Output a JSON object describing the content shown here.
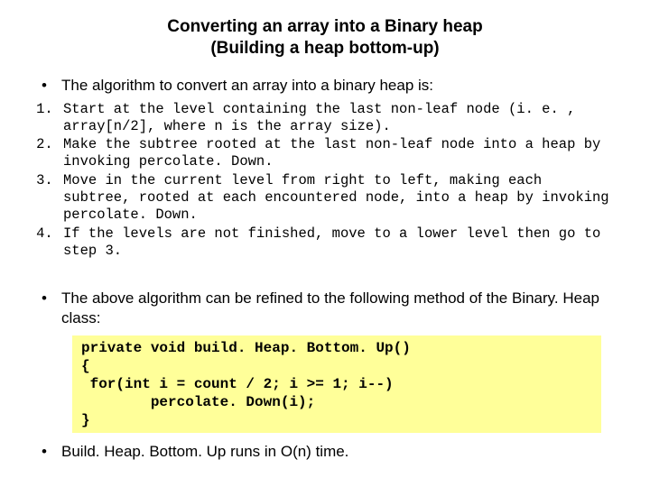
{
  "title_line1": "Converting an array into a Binary heap",
  "title_line2": "(Building a heap bottom-up)",
  "intro": "The algorithm to convert an array into a binary heap is:",
  "steps": [
    "Start at the level containing the last non-leaf node (i. e. , array[n/2], where n is the array size).",
    "Make the subtree rooted at the last non-leaf node into a heap by invoking percolate. Down.",
    "Move in the current level from right to left, making each subtree, rooted at each encountered node, into a heap by invoking percolate. Down.",
    "If the levels are not finished, move to a lower level then go to step 3."
  ],
  "refined": "The above algorithm can be refined to the following method of the Binary. Heap class:",
  "code": "private void build. Heap. Bottom. Up()\n{\n for(int i = count / 2; i >= 1; i--)\n        percolate. Down(i);\n}",
  "runtime": "Build. Heap. Bottom. Up runs in O(n) time."
}
